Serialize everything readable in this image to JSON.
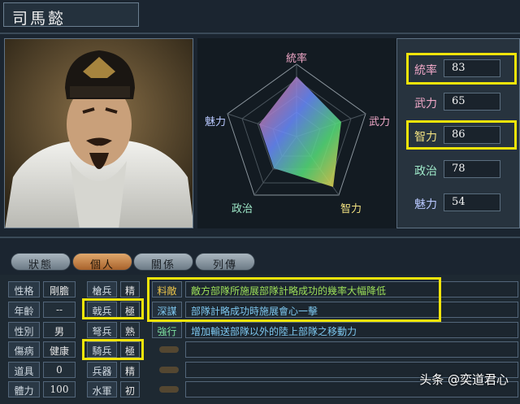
{
  "header": {
    "name": "司馬懿"
  },
  "radar": {
    "labels": {
      "top": "統率",
      "right": "武力",
      "lower_right": "智力",
      "lower_left": "政治",
      "left": "魅力"
    }
  },
  "stats": [
    {
      "label": "統率",
      "value": "83",
      "color": "#f0a8c8",
      "highlighted": true
    },
    {
      "label": "武力",
      "value": "65",
      "color": "#f0a8c8",
      "highlighted": false
    },
    {
      "label": "智力",
      "value": "86",
      "color": "#f0e080",
      "highlighted": true
    },
    {
      "label": "政治",
      "value": "78",
      "color": "#9ee8c8",
      "highlighted": false
    },
    {
      "label": "魅力",
      "value": "54",
      "color": "#b8c8ff",
      "highlighted": false
    }
  ],
  "tabs": [
    {
      "label": "狀態",
      "active": false
    },
    {
      "label": "個人",
      "active": true
    },
    {
      "label": "關係",
      "active": false
    },
    {
      "label": "列傳",
      "active": false
    }
  ],
  "info": [
    {
      "label": "性格",
      "value": "剛膽"
    },
    {
      "label": "年齡",
      "value": "--"
    },
    {
      "label": "性別",
      "value": "男"
    },
    {
      "label": "傷病",
      "value": "健康"
    },
    {
      "label": "道具",
      "value": "0"
    },
    {
      "label": "體力",
      "value": "100"
    }
  ],
  "troops": [
    {
      "label": "槍兵",
      "value": "精"
    },
    {
      "label": "戟兵",
      "value": "極"
    },
    {
      "label": "弩兵",
      "value": "熟"
    },
    {
      "label": "騎兵",
      "value": "極"
    },
    {
      "label": "兵器",
      "value": "精"
    },
    {
      "label": "水軍",
      "value": "初"
    }
  ],
  "skills": [
    {
      "name": "料敵",
      "desc": "敵方部隊所施展部隊計略成功的幾率大幅降低",
      "name_color": "#e8c24a",
      "desc_color": "#9de05a"
    },
    {
      "name": "深謀",
      "desc": "部隊計略成功時施展會心一擊",
      "name_color": "#7ec8f0",
      "desc_color": "#7ec8f0"
    },
    {
      "name": "強行",
      "desc": "增加輸送部隊以外的陸上部隊之移動力",
      "name_color": "#7ee0a0",
      "desc_color": "#7ec8f0"
    }
  ],
  "watermark": "头条 @奕道君心"
}
